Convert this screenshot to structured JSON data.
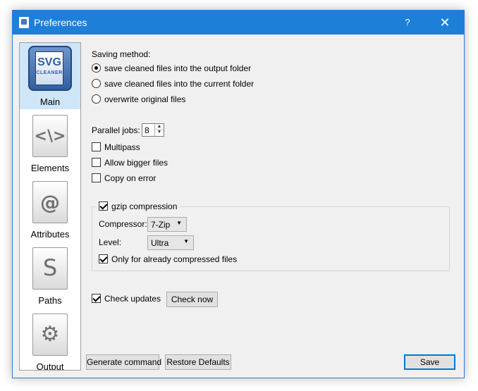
{
  "window": {
    "title": "Preferences",
    "help_label": "?",
    "close_label": "✕"
  },
  "sidebar": {
    "items": [
      {
        "label": "Main",
        "icon": "svg-cleaner-logo-icon",
        "logo_line1": "SVG",
        "logo_line2": "CLEANER",
        "active": true
      },
      {
        "label": "Elements",
        "icon": "code-brackets-icon",
        "glyph": "<\\>"
      },
      {
        "label": "Attributes",
        "icon": "at-sign-icon",
        "glyph": "@"
      },
      {
        "label": "Paths",
        "icon": "bezier-path-icon",
        "glyph": "S"
      },
      {
        "label": "Output",
        "icon": "gear-icon",
        "glyph": "⚙"
      }
    ]
  },
  "main": {
    "saving_method_label": "Saving method:",
    "saving_options": [
      {
        "label": "save cleaned files into the output folder",
        "selected": true
      },
      {
        "label": "save cleaned files into the current folder",
        "selected": false
      },
      {
        "label": "overwrite original files",
        "selected": false
      }
    ],
    "parallel_jobs_label": "Parallel jobs:",
    "parallel_jobs_value": "8",
    "spin_up": "▲",
    "spin_down": "▼",
    "multipass": {
      "label": "Multipass",
      "checked": false
    },
    "allow_bigger": {
      "label": "Allow bigger files",
      "checked": false
    },
    "copy_on_error": {
      "label": "Copy on error",
      "checked": false
    },
    "gzip": {
      "title": "gzip compression",
      "checked": true,
      "compressor_label": "Compressor:",
      "compressor_value": "7-Zip",
      "level_label": "Level:",
      "level_value": "Ultra",
      "dropdown_arrow": "▼",
      "only_compressed": {
        "label": "Only for already compressed files",
        "checked": true
      }
    },
    "check_updates": {
      "label": "Check updates",
      "checked": true
    },
    "check_now_label": "Check now"
  },
  "footer": {
    "generate_command_label": "Generate command",
    "restore_defaults_label": "Restore Defaults",
    "save_label": "Save"
  }
}
